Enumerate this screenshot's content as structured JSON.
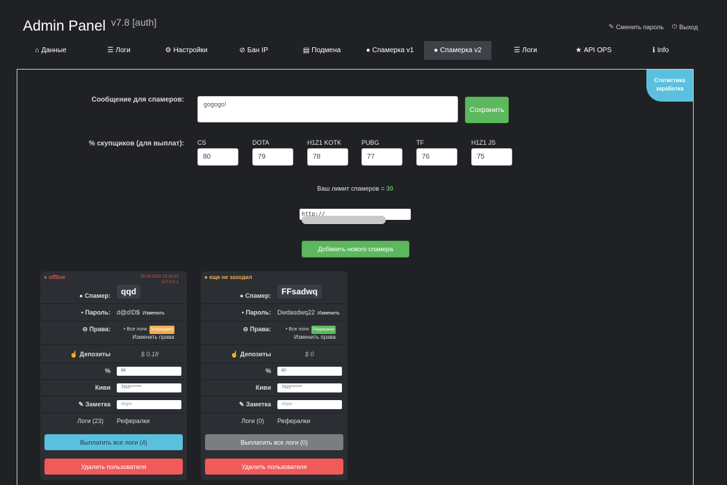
{
  "header": {
    "title": "Admin Panel",
    "version": "v7.8 [auth]",
    "change_password": "Сменить пароль",
    "logout": "Выход"
  },
  "nav": {
    "tabs": [
      {
        "label": "Данные",
        "icon": "home-icon",
        "glyph": "⌂"
      },
      {
        "label": "Логи",
        "icon": "list-icon",
        "glyph": "☰"
      },
      {
        "label": "Настройки",
        "icon": "gear-icon",
        "glyph": "⚙"
      },
      {
        "label": "Бан IP",
        "icon": "ban-icon",
        "glyph": "⊘"
      },
      {
        "label": "Подмена",
        "icon": "file-icon",
        "glyph": "▤"
      },
      {
        "label": "Спамерка v1",
        "icon": "user-icon",
        "glyph": "●"
      },
      {
        "label": "Спамерка v2",
        "icon": "user-icon",
        "glyph": "●"
      },
      {
        "label": "Логи",
        "icon": "list-icon",
        "glyph": "☰"
      },
      {
        "label": "API OPS",
        "icon": "star-icon",
        "glyph": "★"
      },
      {
        "label": "Info",
        "icon": "info-icon",
        "glyph": "ℹ"
      }
    ],
    "active_index": 6
  },
  "badge": {
    "line1": "Статистика",
    "line2": "заработка"
  },
  "message": {
    "label": "Сообщение для спамеров:",
    "value": "gogogo!",
    "save_label": "Сохранить"
  },
  "percent": {
    "label": "% скупщиков (для выплат):",
    "games": [
      {
        "name": "CS",
        "value": "80"
      },
      {
        "name": "DOTA",
        "value": "79"
      },
      {
        "name": "H1Z1 KOTK",
        "value": "78"
      },
      {
        "name": "PUBG",
        "value": "77"
      },
      {
        "name": "TF",
        "value": "76"
      },
      {
        "name": "H1Z1 JS",
        "value": "75"
      }
    ]
  },
  "limit": {
    "text": "Ваш лимит спамеров = ",
    "value": "30"
  },
  "url": {
    "prefix": "http://"
  },
  "add_button": "Добавить нового спамера",
  "colors": {
    "accent_green": "#5cb85c",
    "accent_blue": "#5bc0de",
    "danger": "#f25a5a",
    "offline": "#d9534f",
    "never": "#f0ad4e"
  },
  "labels": {
    "spammer": "Спамер:",
    "password": "Пароль:",
    "rights": "Права:",
    "deposits": "Депозиты",
    "percent": "%",
    "kiwi": "Киви",
    "note": "Заметка",
    "change": "Изменить",
    "all_logs": "• Все логи:",
    "change_rights": "Изменить права",
    "referrals": "Рефералки",
    "delete_user": "Удалить пользователя"
  },
  "cards": [
    {
      "status": "● offline",
      "date": "29.04.2018 15:16:13",
      "ip": "127.0.0.1",
      "name": "qqd",
      "password": "d@d!D$",
      "rights_tag": "Запрещено",
      "deposits": "$ 0.18",
      "percent": "96",
      "kiwi": "7915*******",
      "note_placeholder": "skype",
      "logs": "Логи (23)",
      "pay_button": "Выплатить все логи (4)"
    },
    {
      "status": "● еще не заходил",
      "name": "FFsadwq",
      "password": "Dwdasdwq22",
      "rights_tag": "Разрешено",
      "deposits": "$ 0",
      "percent": "80",
      "kiwi": "7915*******",
      "note_placeholder": "skype",
      "logs": "Логи (0)",
      "pay_button": "Выплатить все логи (0)"
    }
  ]
}
